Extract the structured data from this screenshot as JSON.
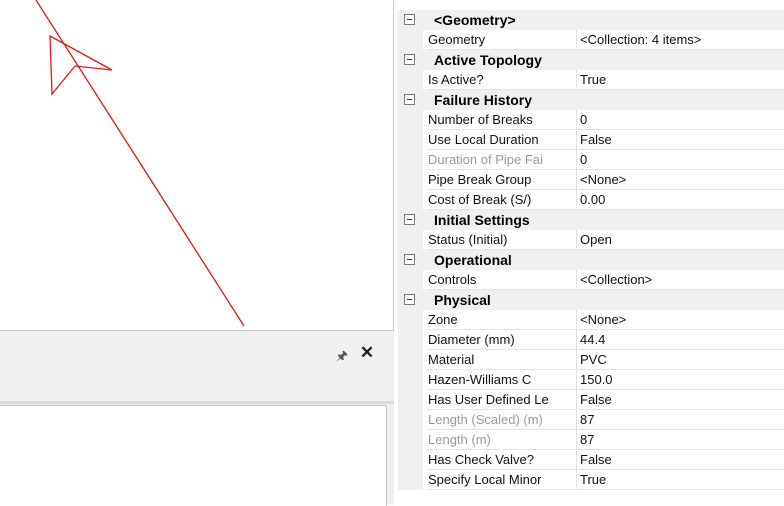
{
  "canvas": {
    "line_color": "#e01818"
  },
  "lower_panel": {
    "pin_icon": "pin-icon",
    "close_icon": "close-icon"
  },
  "property_grid": {
    "sections": [
      {
        "label": "<Geometry>",
        "rows": [
          {
            "name": "Geometry",
            "value": "<Collection: 4 items>",
            "disabled": false
          }
        ]
      },
      {
        "label": "Active Topology",
        "rows": [
          {
            "name": "Is Active?",
            "value": "True",
            "disabled": false
          }
        ]
      },
      {
        "label": "Failure History",
        "rows": [
          {
            "name": "Number of Breaks",
            "value": "0",
            "disabled": false
          },
          {
            "name": "Use Local Duration",
            "value": "False",
            "disabled": false
          },
          {
            "name": "Duration of Pipe Fai",
            "value": "0",
            "disabled": true
          },
          {
            "name": "Pipe Break Group",
            "value": "<None>",
            "disabled": false
          },
          {
            "name": "Cost of Break (S/)",
            "value": "0.00",
            "disabled": false
          }
        ]
      },
      {
        "label": "Initial Settings",
        "rows": [
          {
            "name": "Status (Initial)",
            "value": "Open",
            "disabled": false
          }
        ]
      },
      {
        "label": "Operational",
        "rows": [
          {
            "name": "Controls",
            "value": "<Collection>",
            "disabled": false
          }
        ]
      },
      {
        "label": "Physical",
        "rows": [
          {
            "name": "Zone",
            "value": "<None>",
            "disabled": false
          },
          {
            "name": "Diameter (mm)",
            "value": "44.4",
            "disabled": false
          },
          {
            "name": "Material",
            "value": "PVC",
            "disabled": false
          },
          {
            "name": "Hazen-Williams C",
            "value": "150.0",
            "disabled": false
          },
          {
            "name": "Has User Defined Le",
            "value": "False",
            "disabled": false
          },
          {
            "name": "Length (Scaled) (m)",
            "value": "87",
            "disabled": true
          },
          {
            "name": "Length (m)",
            "value": "87",
            "disabled": true
          },
          {
            "name": "Has Check Valve?",
            "value": "False",
            "disabled": false
          },
          {
            "name": "Specify Local Minor",
            "value": "True",
            "disabled": false
          }
        ]
      }
    ]
  }
}
